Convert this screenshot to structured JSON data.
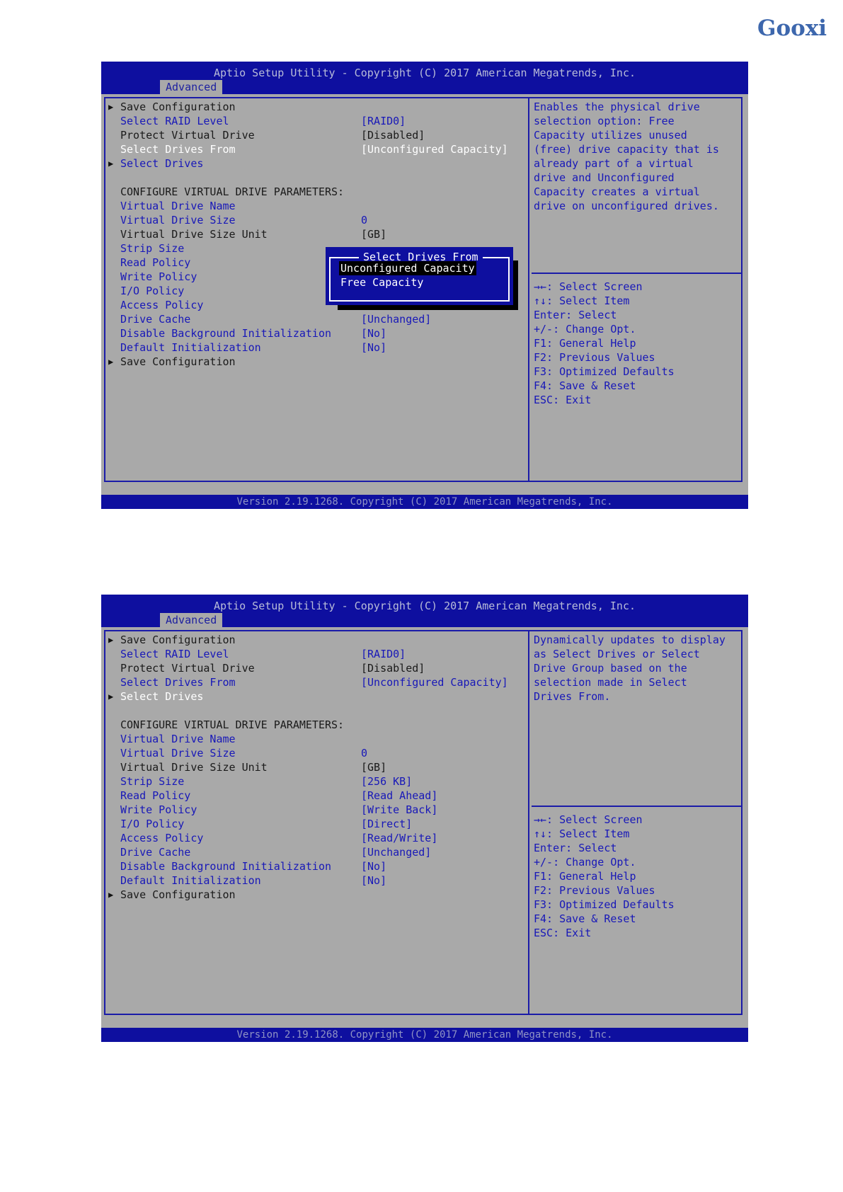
{
  "brand": "Gooxi",
  "screens": [
    {
      "title": "Aptio Setup Utility - Copyright (C) 2017 American Megatrends, Inc.",
      "tab": "Advanced",
      "items": [
        {
          "arrow": "▶",
          "label": "Save Configuration",
          "value": "",
          "style": "black"
        },
        {
          "arrow": "",
          "label": "Select RAID Level",
          "value": "[RAID0]",
          "style": "blue"
        },
        {
          "arrow": "",
          "label": "Protect Virtual Drive",
          "value": "[Disabled]",
          "style": "black"
        },
        {
          "arrow": "",
          "label": "Select Drives From",
          "value": "[Unconfigured Capacity]",
          "style": "white"
        },
        {
          "arrow": "▶",
          "label": "Select Drives",
          "value": "",
          "style": "blue"
        },
        {
          "arrow": "",
          "label": "",
          "value": "",
          "style": "black"
        },
        {
          "arrow": "",
          "label": "CONFIGURE VIRTUAL DRIVE PARAMETERS:",
          "value": "",
          "style": "black"
        },
        {
          "arrow": "",
          "label": "Virtual Drive Name",
          "value": "",
          "style": "blue"
        },
        {
          "arrow": "",
          "label": "Virtual Drive Size",
          "value": "0",
          "style": "blue"
        },
        {
          "arrow": "",
          "label": "Virtual Drive Size Unit",
          "value": "[GB]",
          "style": "black"
        },
        {
          "arrow": "",
          "label": "Strip Size",
          "value": "",
          "style": "blue"
        },
        {
          "arrow": "",
          "label": "Read Policy",
          "value": "",
          "style": "blue"
        },
        {
          "arrow": "",
          "label": "Write Policy",
          "value": "",
          "style": "blue"
        },
        {
          "arrow": "",
          "label": "I/O Policy",
          "value": "",
          "style": "blue"
        },
        {
          "arrow": "",
          "label": "Access Policy",
          "value": "",
          "style": "blue"
        },
        {
          "arrow": "",
          "label": "Drive Cache",
          "value": "[Unchanged]",
          "style": "blue"
        },
        {
          "arrow": "",
          "label": "Disable Background Initialization",
          "value": "[No]",
          "style": "blue"
        },
        {
          "arrow": "",
          "label": "Default Initialization",
          "value": "[No]",
          "style": "blue"
        },
        {
          "arrow": "▶",
          "label": "Save Configuration",
          "value": "",
          "style": "black"
        }
      ],
      "help": "Enables the physical drive\nselection option: Free\nCapacity utilizes unused\n(free) drive capacity that is\nalready part of a virtual\ndrive and Unconfigured\nCapacity creates a virtual\ndrive on unconfigured drives.",
      "keys": "→←: Select Screen\n↑↓: Select Item\nEnter: Select\n+/-: Change Opt.\nF1: General Help\nF2: Previous Values\nF3: Optimized Defaults\nF4: Save & Reset\nESC: Exit",
      "footer": "Version 2.19.1268. Copyright (C) 2017 American Megatrends, Inc.",
      "popup": {
        "title": "Select Drives From",
        "options": [
          "Unconfigured Capacity",
          "Free Capacity"
        ],
        "selected": "Unconfigured Capacity"
      }
    },
    {
      "title": "Aptio Setup Utility - Copyright (C) 2017 American Megatrends, Inc.",
      "tab": "Advanced",
      "items": [
        {
          "arrow": "▶",
          "label": "Save Configuration",
          "value": "",
          "style": "black"
        },
        {
          "arrow": "",
          "label": "Select RAID Level",
          "value": "[RAID0]",
          "style": "blue"
        },
        {
          "arrow": "",
          "label": "Protect Virtual Drive",
          "value": "[Disabled]",
          "style": "black"
        },
        {
          "arrow": "",
          "label": "Select Drives From",
          "value": "[Unconfigured Capacity]",
          "style": "blue"
        },
        {
          "arrow": "▶",
          "label": "Select Drives",
          "value": "",
          "style": "white"
        },
        {
          "arrow": "",
          "label": "",
          "value": "",
          "style": "black"
        },
        {
          "arrow": "",
          "label": "CONFIGURE VIRTUAL DRIVE PARAMETERS:",
          "value": "",
          "style": "black"
        },
        {
          "arrow": "",
          "label": "Virtual Drive Name",
          "value": "",
          "style": "blue"
        },
        {
          "arrow": "",
          "label": "Virtual Drive Size",
          "value": "0",
          "style": "blue"
        },
        {
          "arrow": "",
          "label": "Virtual Drive Size Unit",
          "value": "[GB]",
          "style": "black"
        },
        {
          "arrow": "",
          "label": "Strip Size",
          "value": "[256 KB]",
          "style": "blue"
        },
        {
          "arrow": "",
          "label": "Read Policy",
          "value": "[Read Ahead]",
          "style": "blue"
        },
        {
          "arrow": "",
          "label": "Write Policy",
          "value": "[Write Back]",
          "style": "blue"
        },
        {
          "arrow": "",
          "label": "I/O Policy",
          "value": "[Direct]",
          "style": "blue"
        },
        {
          "arrow": "",
          "label": "Access Policy",
          "value": "[Read/Write]",
          "style": "blue"
        },
        {
          "arrow": "",
          "label": "Drive Cache",
          "value": "[Unchanged]",
          "style": "blue"
        },
        {
          "arrow": "",
          "label": "Disable Background Initialization",
          "value": "[No]",
          "style": "blue"
        },
        {
          "arrow": "",
          "label": "Default Initialization",
          "value": "[No]",
          "style": "blue"
        },
        {
          "arrow": "▶",
          "label": "Save Configuration",
          "value": "",
          "style": "black"
        }
      ],
      "help": "Dynamically updates to display\nas Select Drives or Select\nDrive Group based on the\nselection made in Select\nDrives From.",
      "keys": "→←: Select Screen\n↑↓: Select Item\nEnter: Select\n+/-: Change Opt.\nF1: General Help\nF2: Previous Values\nF3: Optimized Defaults\nF4: Save & Reset\nESC: Exit",
      "footer": "Version 2.19.1268. Copyright (C) 2017 American Megatrends, Inc."
    }
  ]
}
